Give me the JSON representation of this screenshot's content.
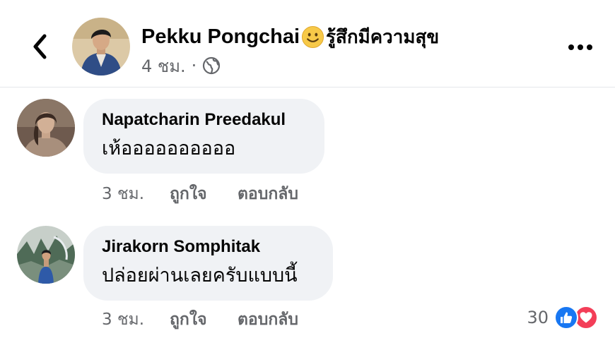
{
  "post": {
    "author": "Pekku Pongchai",
    "feeling_text": "รู้สึกมีความสุข",
    "time": "4 ชม.",
    "separator": "·"
  },
  "comments": [
    {
      "author": "Napatcharin Preedakul",
      "text": "เห้ออออออออออ",
      "time": "3 ชม.",
      "like_label": "ถูกใจ",
      "reply_label": "ตอบกลับ"
    },
    {
      "author": "Jirakorn Somphitak",
      "text": "ปล่อยผ่านเลยครับแบบนี้",
      "time": "3 ชม.",
      "like_label": "ถูกใจ",
      "reply_label": "ตอบกลับ",
      "reaction_count": "30"
    }
  ],
  "icons": {
    "back": "chevron-left-icon",
    "globe": "globe-icon",
    "more": "more-horizontal-icon",
    "feeling": "smiley-icon",
    "like_reaction": "thumbs-up-icon",
    "love_reaction": "heart-icon"
  },
  "colors": {
    "bubble": "#f0f2f5",
    "meta_text": "#65676b",
    "like_blue": "#1877f2",
    "love_red": "#f33e58"
  }
}
